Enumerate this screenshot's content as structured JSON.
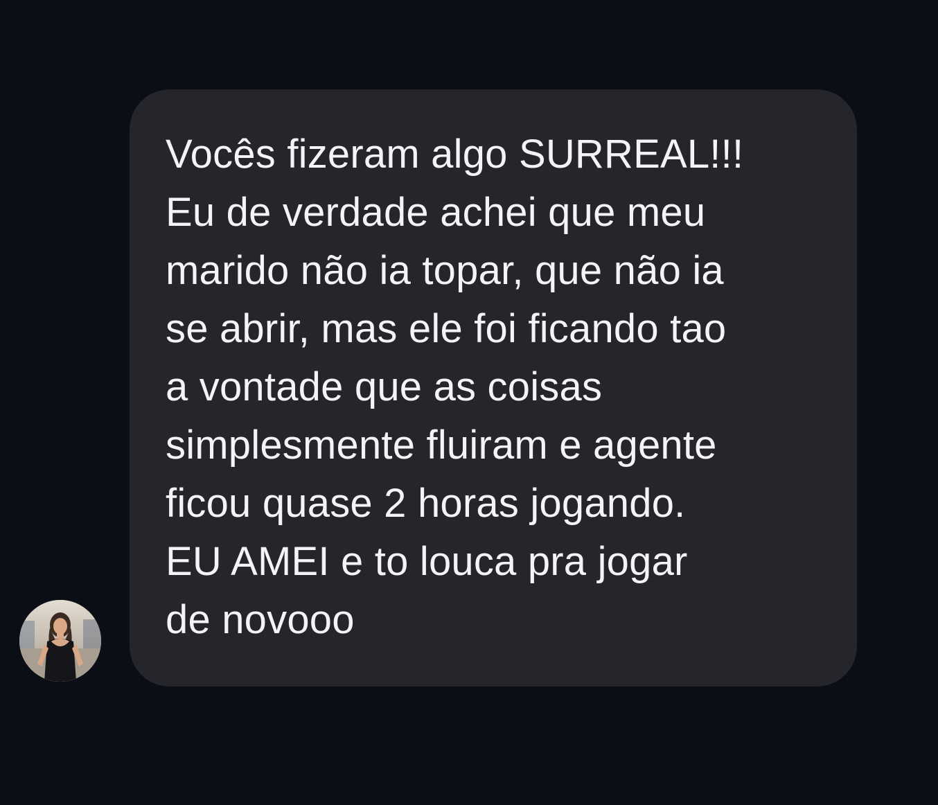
{
  "conversation": {
    "message": {
      "lines": [
        "Vocês fizeram algo SURREAL!!!",
        "Eu de verdade achei que meu",
        "marido não ia topar, que não ia",
        "se abrir, mas ele foi ficando tao",
        "a vontade que as coisas",
        "simplesmente fluiram e agente",
        "ficou quase 2 horas jogando.",
        "EU AMEI e to louca pra jogar",
        "de novooo"
      ]
    },
    "sender": {
      "avatar_icon": "user-avatar-photo"
    },
    "colors": {
      "background": "#0c0e15",
      "bubble": "#24262b",
      "text": "#f4f4f6"
    }
  }
}
